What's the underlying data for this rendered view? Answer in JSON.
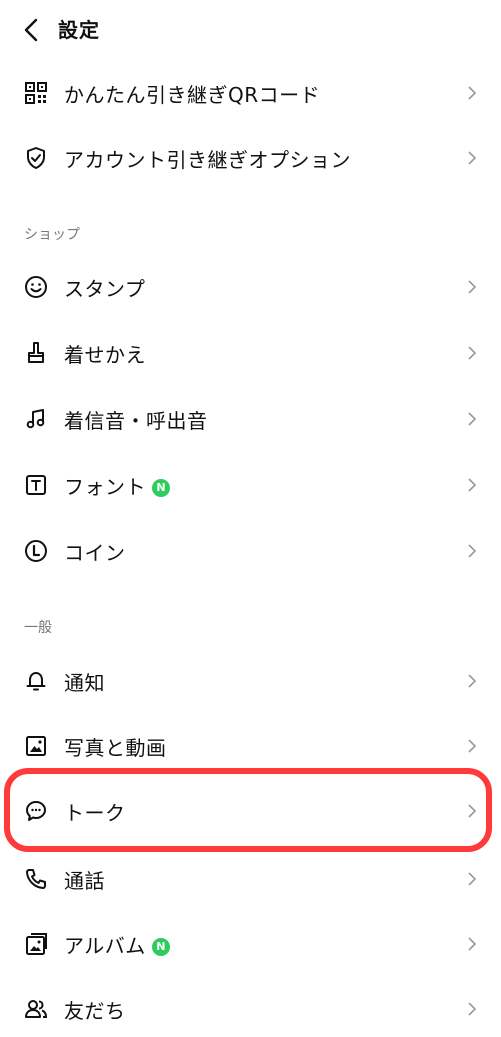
{
  "header": {
    "title": "設定"
  },
  "rows_top": [
    {
      "name": "qr-handover",
      "label": "かんたん引き継ぎQRコード",
      "icon": "qr-code-icon"
    },
    {
      "name": "account-handover",
      "label": "アカウント引き継ぎオプション",
      "icon": "shield-check-icon"
    }
  ],
  "shop": {
    "heading": "ショップ",
    "items": [
      {
        "name": "stickers",
        "label": "スタンプ",
        "icon": "smiley-icon"
      },
      {
        "name": "themes",
        "label": "着せかえ",
        "icon": "brush-icon"
      },
      {
        "name": "ringtones",
        "label": "着信音・呼出音",
        "icon": "music-note-icon"
      },
      {
        "name": "fonts",
        "label": "フォント",
        "icon": "text-t-icon",
        "badge": "N"
      },
      {
        "name": "coins",
        "label": "コイン",
        "icon": "coin-icon"
      }
    ]
  },
  "general": {
    "heading": "一般",
    "items": [
      {
        "name": "notifications",
        "label": "通知",
        "icon": "bell-icon"
      },
      {
        "name": "photos-videos",
        "label": "写真と動画",
        "icon": "image-icon"
      },
      {
        "name": "chats",
        "label": "トーク",
        "icon": "chat-bubble-icon"
      },
      {
        "name": "calls",
        "label": "通話",
        "icon": "phone-icon"
      },
      {
        "name": "album",
        "label": "アルバム",
        "icon": "album-icon",
        "badge": "N"
      },
      {
        "name": "friends",
        "label": "友だち",
        "icon": "friends-icon"
      }
    ]
  },
  "highlight_color": "#ff3a3a",
  "badge_color": "#2ecc5e"
}
